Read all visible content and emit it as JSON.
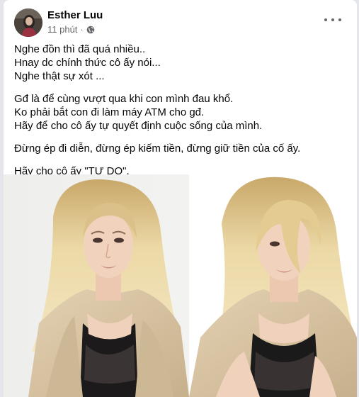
{
  "post": {
    "author": "Esther Luu",
    "time": "11 phút",
    "separator": "·",
    "privacy_icon": "globe-icon",
    "menu_icon": "more-options-icon",
    "paragraphs": [
      [
        "Nghe đồn thì đã quá nhiều..",
        "Hnay dc chính thức cô ấy nói...",
        "Nghe thật sự xót ..."
      ],
      [
        "Gđ là để cùng vượt qua khi con mình đau khổ.",
        "Ko phải bắt con đi làm máy ATM cho gđ.",
        "Hãy để cho cô ấy tự quyết định cuộc sống của mình."
      ],
      [
        "Đừng ép đi diễn, đừng ép kiếm tiền, đừng giữ tiền của cố ấy."
      ],
      [
        "Hãy cho cô ấy \"TỰ DO\"."
      ]
    ]
  },
  "colors": {
    "page_bg": "#e4e6eb",
    "card_bg": "#ffffff",
    "text": "#050505",
    "secondary": "#65676b",
    "jacket": "#d9c5a6",
    "hair": "#e6cf97",
    "skin": "#f0d3bf"
  }
}
